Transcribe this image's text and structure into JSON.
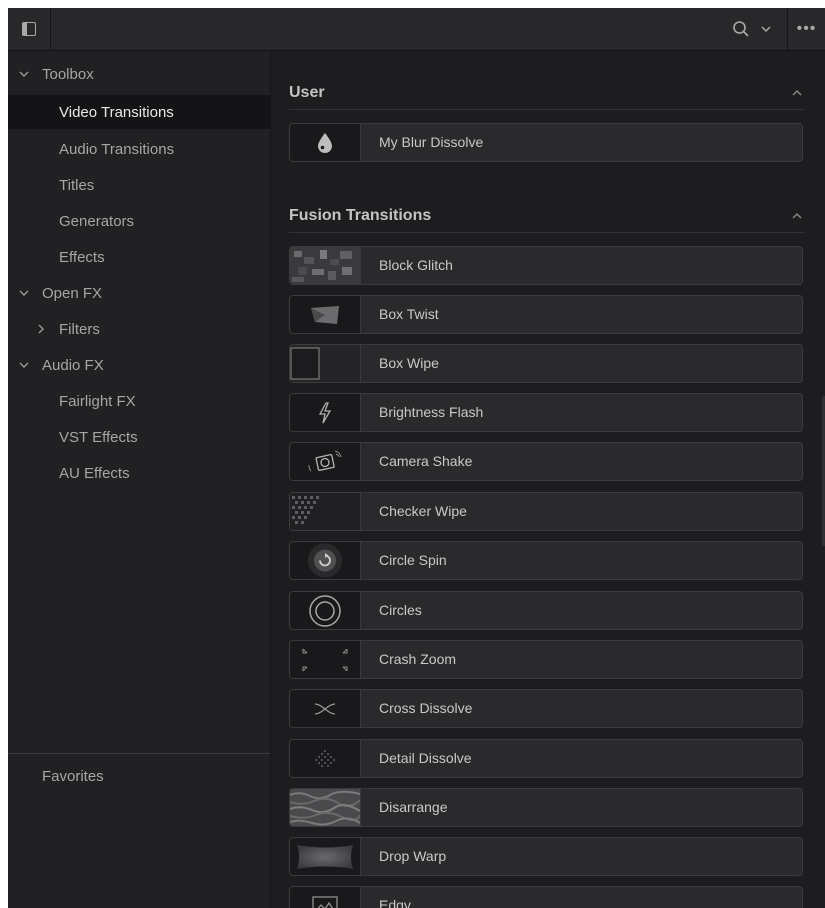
{
  "toolbar": {
    "panel_toggle_icon": "panel-toggle-icon",
    "search_icon": "search-icon",
    "dropdown_icon": "chevron-down-icon",
    "more_label": "•••"
  },
  "sidebar": {
    "items": [
      {
        "label": "Toolbox",
        "expanded": true,
        "has_chevron": true,
        "selected": false
      },
      {
        "label": "Video Transitions",
        "selected": true
      },
      {
        "label": "Audio Transitions",
        "selected": false
      },
      {
        "label": "Titles",
        "selected": false
      },
      {
        "label": "Generators",
        "selected": false
      },
      {
        "label": "Effects",
        "selected": false
      },
      {
        "label": "Open FX",
        "expanded": true,
        "has_chevron": true,
        "selected": false
      },
      {
        "label": "Filters",
        "expanded": false,
        "has_chevron": true,
        "selected": false
      },
      {
        "label": "Audio FX",
        "expanded": true,
        "has_chevron": true,
        "selected": false
      },
      {
        "label": "Fairlight FX",
        "selected": false
      },
      {
        "label": "VST Effects",
        "selected": false
      },
      {
        "label": "AU Effects",
        "selected": false
      }
    ],
    "favorites_label": "Favorites"
  },
  "content": {
    "user_section": {
      "title": "User",
      "items": [
        {
          "label": "My Blur Dissolve",
          "icon": "droplet-icon"
        }
      ]
    },
    "fusion_section": {
      "title": "Fusion Transitions",
      "items": [
        {
          "label": "Block Glitch",
          "icon": "block-glitch-thumbnail"
        },
        {
          "label": "Box Twist",
          "icon": "box-twist-thumbnail"
        },
        {
          "label": "Box Wipe",
          "icon": "box-wipe-thumbnail"
        },
        {
          "label": "Brightness Flash",
          "icon": "lightning-icon"
        },
        {
          "label": "Camera Shake",
          "icon": "camera-shake-icon"
        },
        {
          "label": "Checker Wipe",
          "icon": "checker-wipe-thumbnail"
        },
        {
          "label": "Circle Spin",
          "icon": "circle-spin-icon"
        },
        {
          "label": "Circles",
          "icon": "concentric-circles-icon"
        },
        {
          "label": "Crash Zoom",
          "icon": "crash-zoom-icon"
        },
        {
          "label": "Cross Dissolve",
          "icon": "cross-dissolve-icon"
        },
        {
          "label": "Detail Dissolve",
          "icon": "detail-dissolve-thumbnail"
        },
        {
          "label": "Disarrange",
          "icon": "disarrange-thumbnail"
        },
        {
          "label": "Drop Warp",
          "icon": "drop-warp-thumbnail"
        },
        {
          "label": "Edgy",
          "icon": "image-icon"
        }
      ]
    }
  }
}
